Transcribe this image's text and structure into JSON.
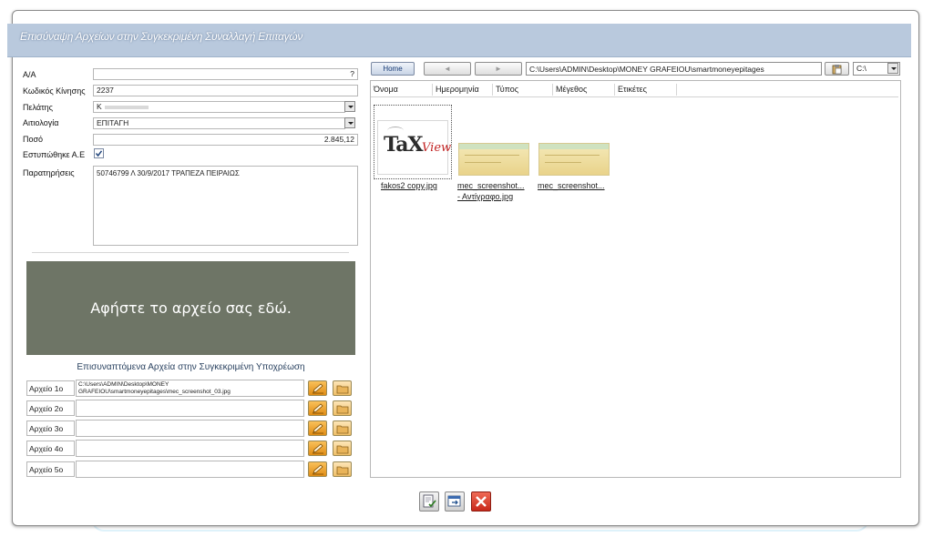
{
  "window": {
    "title": "Επισύναψη Αρχείων στην Συγκεκριμένη Συναλλαγή Επιταγών"
  },
  "form": {
    "aa_label": "Α/Α",
    "aa_value": "?",
    "code_label": "Κωδικός Κίνησης",
    "code_value": "2237",
    "customer_label": "Πελάτης",
    "customer_value": "Κ",
    "reason_label": "Αιτιολογία",
    "reason_value": "ΕΠΙΤΑΓΗ",
    "amount_label": "Ποσό",
    "amount_value": "2.845,12",
    "sent_label": "Εστυπώθηκε Α.Ε",
    "sent_checked": true,
    "notes_label": "Παρατηρήσεις",
    "notes_value": "50746799 Λ 30/9/2017 ΤΡΑΠΕΖΑ ΠΕΙΡΑΙΩΣ"
  },
  "dropzone": {
    "text": "Αφήστε το αρχείο σας εδώ."
  },
  "attachments": {
    "heading": "Επισυναπτόμενα Αρχεία στην Συγκεκριμένη Υποχρέωση",
    "rows": [
      {
        "label": "Αρχείο 1ο",
        "path": "C:\\Users\\ADMIN\\Desktop\\MONEY GRAFEIOU\\smartmoneyepitages\\mec_screenshot_03.jpg"
      },
      {
        "label": "Αρχείο 2ο",
        "path": ""
      },
      {
        "label": "Αρχείο 3ο",
        "path": ""
      },
      {
        "label": "Αρχείο 4ο",
        "path": ""
      },
      {
        "label": "Αρχείο 5ο",
        "path": ""
      }
    ]
  },
  "browser": {
    "home_label": "Home",
    "back_label": "◄",
    "forward_label": "►",
    "path": "C:\\Users\\ADMIN\\Desktop\\MONEY GRAFEIOU\\smartmoneyepitages",
    "drive": "C:\\",
    "columns": [
      "Όνομα",
      "Ημερομηνία",
      "Τύπος",
      "Μέγεθος",
      "Ετικέτες"
    ],
    "files": [
      {
        "name": "fakos2 copy.jpg",
        "logo_text": "TaX",
        "logo_text2": "View"
      },
      {
        "name_line1": "mec_screenshot...",
        "name_line2": "- Αντίγραφο.jpg"
      },
      {
        "name_line1": "mec_screenshot..."
      }
    ]
  },
  "colors": {
    "titlebar": "#b9c9dd",
    "dropzone": "#6e7566",
    "button_orange": "#e08d16",
    "close_red": "#d63a2a"
  }
}
